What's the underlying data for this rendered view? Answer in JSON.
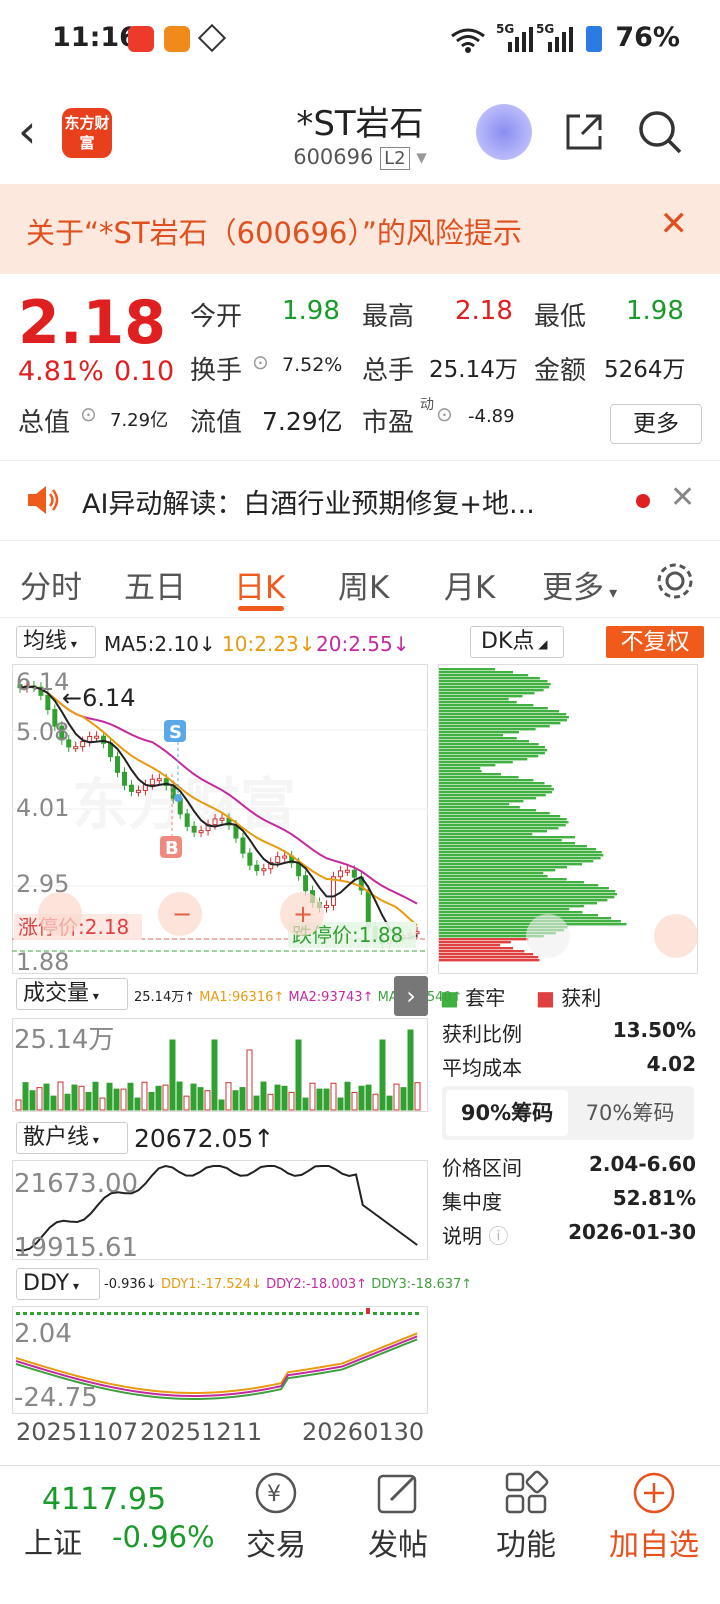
{
  "status": {
    "time": "11:16",
    "network1": "5G",
    "network2": "5G",
    "battery": "76%"
  },
  "header": {
    "logo": "东方财富",
    "title": "*ST岩石",
    "code": "600696",
    "level": "L2"
  },
  "banner": {
    "text": "关于“*ST岩石（600696）”的风险提示"
  },
  "quote": {
    "price": "2.18",
    "change_pct": "4.81%",
    "change": "0.10",
    "open_label": "今开",
    "open": "1.98",
    "high_label": "最高",
    "high": "2.18",
    "low_label": "最低",
    "low": "1.98",
    "turnover_label": "换手",
    "turnover": "7.52%",
    "vol_label": "总手",
    "vol": "25.14万",
    "amount_label": "金额",
    "amount": "5264万",
    "mcap_label": "总值",
    "mcap": "7.29亿",
    "float_label": "流值",
    "float": "7.29亿",
    "pe_label": "市盈",
    "pe_sup": "动",
    "pe": "-4.89",
    "more": "更多"
  },
  "ai": {
    "text": "AI异动解读：白酒行业预期修复+地..."
  },
  "tabs": [
    "分时",
    "五日",
    "日K",
    "周K",
    "月K",
    "更多"
  ],
  "kline": {
    "ma_btn": "均线",
    "ma5": "MA5:2.10↓",
    "ma10": "10:2.23↓",
    "ma20": "20:2.55↓",
    "dk_btn": "DK点",
    "adj_btn": "不复权",
    "y_labels": [
      "6.14",
      "5.08",
      "4.01",
      "2.95",
      "1.88"
    ],
    "max_label": "6.14",
    "limit_up": "涨停价:2.18",
    "limit_down": "跌停价:1.88",
    "sell": "S",
    "buy": "B"
  },
  "volume": {
    "btn": "成交量",
    "val": "25.14万↑",
    "ma1": "MA1:96316↑",
    "ma2": "MA2:93743↑",
    "ma3": "MA3:71540↑",
    "y": "25.14万"
  },
  "retail": {
    "btn": "散户线",
    "val": "20672.05↑",
    "y_top": "21673.00",
    "y_bot": "19915.61"
  },
  "ddy": {
    "btn": "DDY",
    "val": "-0.936↓",
    "d1": "DDY1:-17.524↓",
    "d2": "DDY2:-18.003↑",
    "d3": "DDY3:-18.637↑",
    "y_top": "2.04",
    "y_bot": "-24.75"
  },
  "dates": [
    "20251107",
    "20251211",
    "20260130"
  ],
  "chips": {
    "legend_trap": "套牢",
    "legend_profit": "获利",
    "profit_ratio_label": "获利比例",
    "profit_ratio": "13.50%",
    "avg_cost_label": "平均成本",
    "avg_cost": "4.02",
    "tab90": "90%筹码",
    "tab70": "70%筹码",
    "range_label": "价格区间",
    "range": "2.04-6.60",
    "conc_label": "集中度",
    "conc": "52.81%",
    "note_label": "说明",
    "note": "2026-01-30"
  },
  "bottom": {
    "index_value": "4117.95",
    "index_name": "上证",
    "index_change": "-0.96%",
    "trade": "交易",
    "post": "发帖",
    "func": "功能",
    "add": "加自选"
  }
}
